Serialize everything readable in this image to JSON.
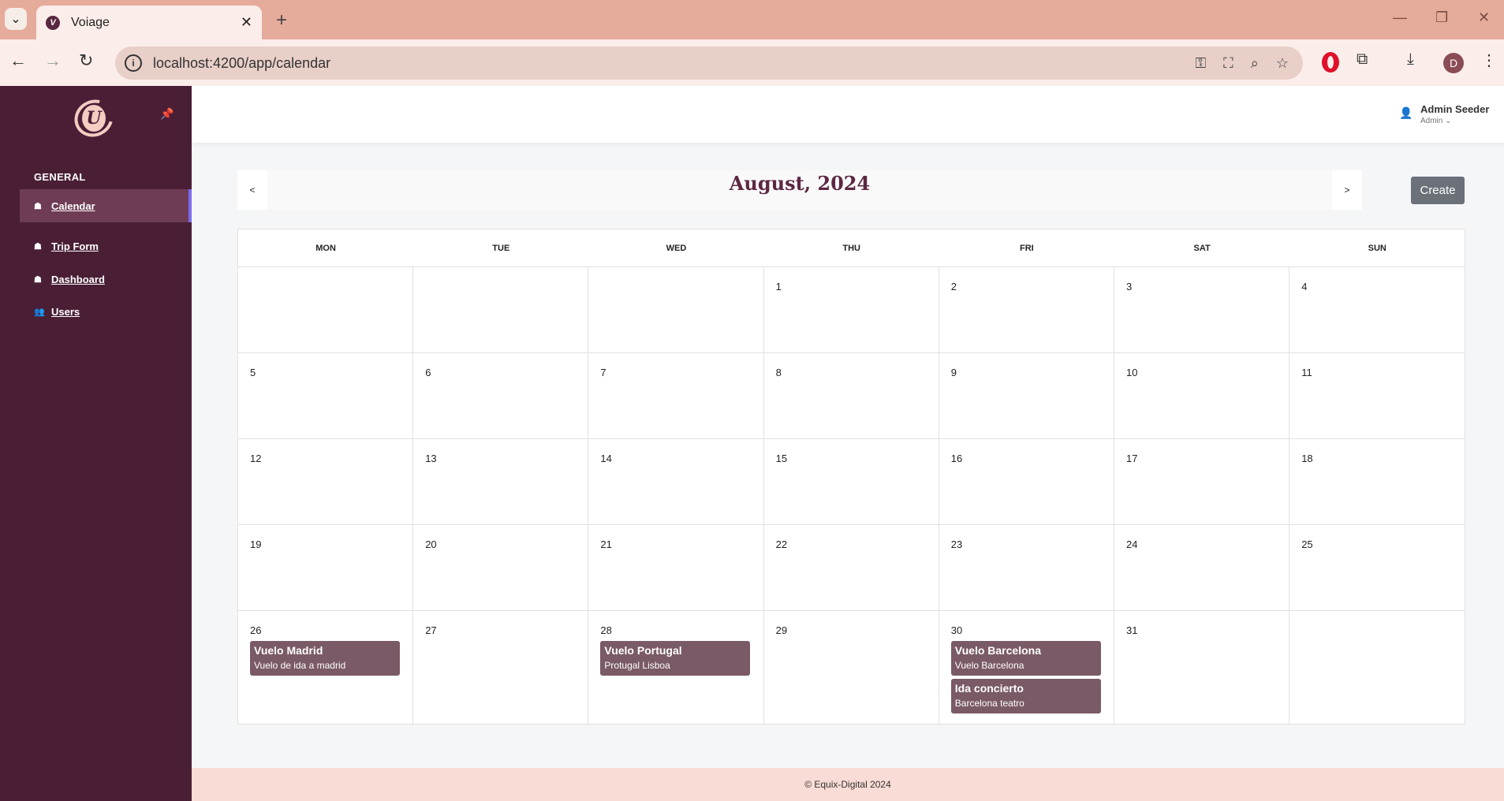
{
  "browser": {
    "tab_title": "Voiage",
    "tab_favicon": "V",
    "new_tab": "+",
    "url": "localhost:4200/app/calendar",
    "profile_initial": "D"
  },
  "sidebar": {
    "section_title": "GENERAL",
    "items": [
      {
        "label": "Calendar",
        "icon": "suitcase-icon",
        "active": true
      },
      {
        "label": "Trip Form",
        "icon": "suitcase-icon",
        "active": false
      },
      {
        "label": "Dashboard",
        "icon": "suitcase-icon",
        "active": false
      },
      {
        "label": "Users",
        "icon": "users-icon",
        "active": false
      }
    ]
  },
  "header": {
    "user_name": "Admin Seeder",
    "user_role": "Admin"
  },
  "calendar": {
    "title": "August, 2024",
    "prev_label": "<",
    "next_label": ">",
    "create_label": "Create",
    "weekdays": [
      "MON",
      "TUE",
      "WED",
      "THU",
      "FRI",
      "SAT",
      "SUN"
    ],
    "weeks": [
      [
        "",
        "",
        "",
        "1",
        "2",
        "3",
        "4"
      ],
      [
        "5",
        "6",
        "7",
        "8",
        "9",
        "10",
        "11"
      ],
      [
        "12",
        "13",
        "14",
        "15",
        "16",
        "17",
        "18"
      ],
      [
        "19",
        "20",
        "21",
        "22",
        "23",
        "24",
        "25"
      ],
      [
        "26",
        "27",
        "28",
        "29",
        "30",
        "31",
        ""
      ]
    ],
    "events": {
      "26": [
        {
          "title": "Vuelo Madrid",
          "description": "Vuelo de ida a madrid"
        }
      ],
      "28": [
        {
          "title": "Vuelo Portugal",
          "description": "Protugal Lisboa"
        }
      ],
      "30": [
        {
          "title": "Vuelo Barcelona",
          "description": "Vuelo Barcelona"
        },
        {
          "title": "Ida concierto",
          "description": "Barcelona teatro"
        }
      ]
    },
    "event_color": "#7a5a66"
  },
  "footer": {
    "text": "© Equix-Digital 2024"
  },
  "colors": {
    "sidebar": "#4a1f36",
    "sidebar_active": "#6e3c55",
    "title": "#5c2742",
    "footer": "#f9dcd5"
  }
}
